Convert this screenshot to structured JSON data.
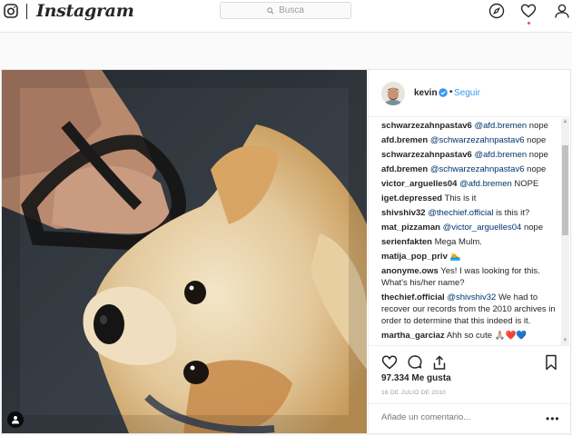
{
  "nav": {
    "brand": "Instagram",
    "search_placeholder": "Busca",
    "icons": [
      "camera-icon",
      "explore-compass-icon",
      "activity-heart-icon",
      "profile-icon"
    ]
  },
  "post": {
    "owner": {
      "username": "kevin",
      "verified": true,
      "follow_label": "Seguir",
      "separator": "•"
    },
    "comments": [
      {
        "user": "schwarzezahnpastav6",
        "mention": "@afd.bremen",
        "text": " nope"
      },
      {
        "user": "afd.bremen",
        "mention": "@schwarzezahnpastav6",
        "text": " nope"
      },
      {
        "user": "schwarzezahnpastav6",
        "mention": "@afd.bremen",
        "text": " nope"
      },
      {
        "user": "afd.bremen",
        "mention": "@schwarzezahnpastav6",
        "text": " nope"
      },
      {
        "user": "victor_arguelles04",
        "mention": "@afd.bremen",
        "text": " NOPE"
      },
      {
        "user": "iget.depressed",
        "mention": "",
        "text": "This is it"
      },
      {
        "user": "shivshiv32",
        "mention": "@thechief.official",
        "text": " is this it?"
      },
      {
        "user": "mat_pizzaman",
        "mention": "@victor_arguelles04",
        "text": " nope"
      },
      {
        "user": "serienfakten",
        "mention": "",
        "text": "Mega Mulm."
      },
      {
        "user": "matija_pop_priv",
        "mention": "",
        "text": "🏊"
      },
      {
        "user": "anonyme.ows",
        "mention": "",
        "text": "Yes! I was looking for this. What's his/her name?"
      },
      {
        "user": "thechief.official",
        "mention": "@shivshiv32",
        "text": " We had to recover our records from the 2010 archives in order to determine that this indeed is it."
      },
      {
        "user": "martha_garciaz",
        "mention": "",
        "text": "Ahh so cute 🙏🏼❤️💙"
      }
    ],
    "likes": "97.334 Me gusta",
    "date": "16 DE JULIO DE 2010",
    "comment_placeholder": "Añade un comentario...",
    "more_label": "•••",
    "colors": {
      "link": "#3897f0",
      "mention": "#003569",
      "verified": "#3897f0",
      "text": "#262626",
      "muted": "#999999"
    }
  }
}
